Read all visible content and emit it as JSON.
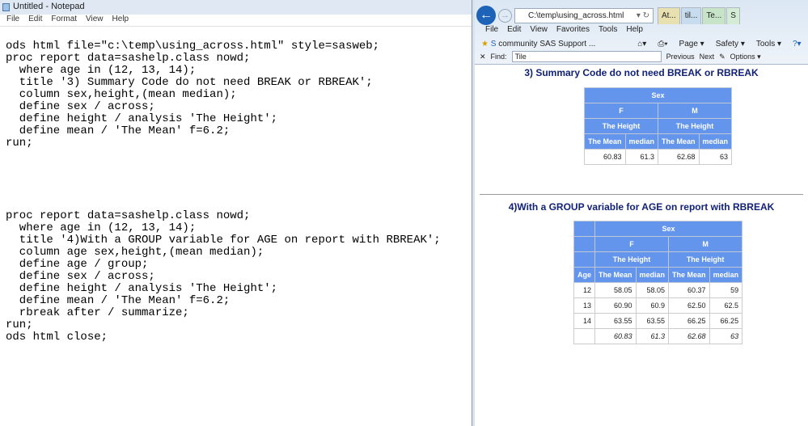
{
  "notepad": {
    "title": "Untitled - Notepad",
    "menu": [
      "File",
      "Edit",
      "Format",
      "View",
      "Help"
    ],
    "code": [
      "ods html file=\"c:\\temp\\using_across.html\" style=sasweb;",
      "proc report data=sashelp.class nowd;",
      "  where age in (12, 13, 14);",
      "  title '3) Summary Code do not need BREAK or RBREAK';",
      "  column sex,height,(mean median);",
      "  define sex / across;",
      "  define height / analysis 'The Height';",
      "  define mean / 'The Mean' f=6.2;",
      "run;",
      "",
      "",
      "",
      "",
      "",
      "proc report data=sashelp.class nowd;",
      "  where age in (12, 13, 14);",
      "  title '4)With a GROUP variable for AGE on report with RBREAK';",
      "  column age sex,height,(mean median);",
      "  define age / group;",
      "  define sex / across;",
      "  define height / analysis 'The Height';",
      "  define mean / 'The Mean' f=6.2;",
      "  rbreak after / summarize;",
      "run;",
      "ods html close;"
    ]
  },
  "browser": {
    "address": "C:\\temp\\using_across.html",
    "tabs": [
      "At...",
      "til...",
      "Te...",
      "S"
    ],
    "menu": [
      "File",
      "Edit",
      "View",
      "Favorites",
      "Tools",
      "Help"
    ],
    "favorite": "community SAS Support ...",
    "toolbar": [
      "Page ▾",
      "Safety ▾",
      "Tools ▾"
    ],
    "find_label": "Find:",
    "find_value": "Tile",
    "previous": "Previous",
    "next": "Next",
    "options": "Options ▾"
  },
  "report1": {
    "title": "3) Summary Code do not need BREAK or RBREAK",
    "sex": "Sex",
    "f": "F",
    "m": "M",
    "height": "The Height",
    "mean": "The Mean",
    "median": "median",
    "row": [
      "60.83",
      "61.3",
      "62.68",
      "63"
    ]
  },
  "report2": {
    "title": "4)With a GROUP variable for AGE on report with RBREAK",
    "age": "Age",
    "rows": [
      [
        "12",
        "58.05",
        "58.05",
        "60.37",
        "59"
      ],
      [
        "13",
        "60.90",
        "60.9",
        "62.50",
        "62.5"
      ],
      [
        "14",
        "63.55",
        "63.55",
        "66.25",
        "66.25"
      ],
      [
        "",
        "60.83",
        "61.3",
        "62.68",
        "63"
      ]
    ]
  }
}
